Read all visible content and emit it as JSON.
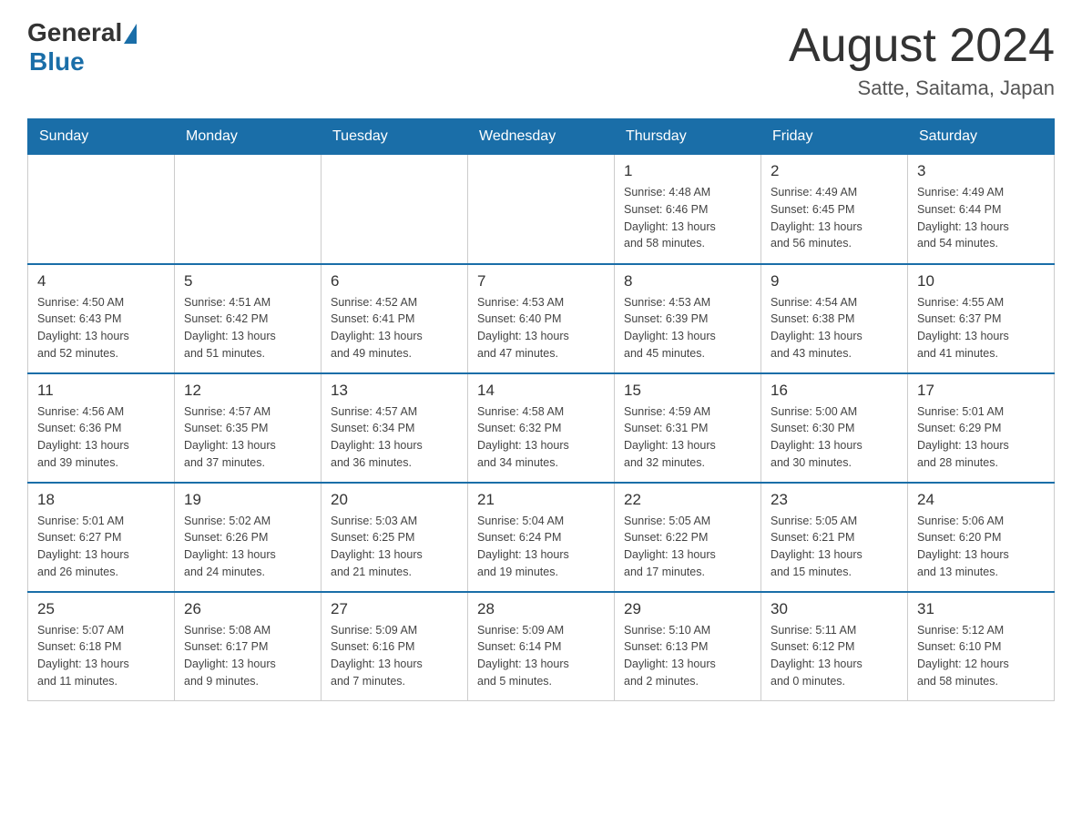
{
  "header": {
    "logo_general": "General",
    "logo_blue": "Blue",
    "title": "August 2024",
    "location": "Satte, Saitama, Japan"
  },
  "weekdays": [
    "Sunday",
    "Monday",
    "Tuesday",
    "Wednesday",
    "Thursday",
    "Friday",
    "Saturday"
  ],
  "weeks": [
    [
      {
        "day": "",
        "info": ""
      },
      {
        "day": "",
        "info": ""
      },
      {
        "day": "",
        "info": ""
      },
      {
        "day": "",
        "info": ""
      },
      {
        "day": "1",
        "info": "Sunrise: 4:48 AM\nSunset: 6:46 PM\nDaylight: 13 hours\nand 58 minutes."
      },
      {
        "day": "2",
        "info": "Sunrise: 4:49 AM\nSunset: 6:45 PM\nDaylight: 13 hours\nand 56 minutes."
      },
      {
        "day": "3",
        "info": "Sunrise: 4:49 AM\nSunset: 6:44 PM\nDaylight: 13 hours\nand 54 minutes."
      }
    ],
    [
      {
        "day": "4",
        "info": "Sunrise: 4:50 AM\nSunset: 6:43 PM\nDaylight: 13 hours\nand 52 minutes."
      },
      {
        "day": "5",
        "info": "Sunrise: 4:51 AM\nSunset: 6:42 PM\nDaylight: 13 hours\nand 51 minutes."
      },
      {
        "day": "6",
        "info": "Sunrise: 4:52 AM\nSunset: 6:41 PM\nDaylight: 13 hours\nand 49 minutes."
      },
      {
        "day": "7",
        "info": "Sunrise: 4:53 AM\nSunset: 6:40 PM\nDaylight: 13 hours\nand 47 minutes."
      },
      {
        "day": "8",
        "info": "Sunrise: 4:53 AM\nSunset: 6:39 PM\nDaylight: 13 hours\nand 45 minutes."
      },
      {
        "day": "9",
        "info": "Sunrise: 4:54 AM\nSunset: 6:38 PM\nDaylight: 13 hours\nand 43 minutes."
      },
      {
        "day": "10",
        "info": "Sunrise: 4:55 AM\nSunset: 6:37 PM\nDaylight: 13 hours\nand 41 minutes."
      }
    ],
    [
      {
        "day": "11",
        "info": "Sunrise: 4:56 AM\nSunset: 6:36 PM\nDaylight: 13 hours\nand 39 minutes."
      },
      {
        "day": "12",
        "info": "Sunrise: 4:57 AM\nSunset: 6:35 PM\nDaylight: 13 hours\nand 37 minutes."
      },
      {
        "day": "13",
        "info": "Sunrise: 4:57 AM\nSunset: 6:34 PM\nDaylight: 13 hours\nand 36 minutes."
      },
      {
        "day": "14",
        "info": "Sunrise: 4:58 AM\nSunset: 6:32 PM\nDaylight: 13 hours\nand 34 minutes."
      },
      {
        "day": "15",
        "info": "Sunrise: 4:59 AM\nSunset: 6:31 PM\nDaylight: 13 hours\nand 32 minutes."
      },
      {
        "day": "16",
        "info": "Sunrise: 5:00 AM\nSunset: 6:30 PM\nDaylight: 13 hours\nand 30 minutes."
      },
      {
        "day": "17",
        "info": "Sunrise: 5:01 AM\nSunset: 6:29 PM\nDaylight: 13 hours\nand 28 minutes."
      }
    ],
    [
      {
        "day": "18",
        "info": "Sunrise: 5:01 AM\nSunset: 6:27 PM\nDaylight: 13 hours\nand 26 minutes."
      },
      {
        "day": "19",
        "info": "Sunrise: 5:02 AM\nSunset: 6:26 PM\nDaylight: 13 hours\nand 24 minutes."
      },
      {
        "day": "20",
        "info": "Sunrise: 5:03 AM\nSunset: 6:25 PM\nDaylight: 13 hours\nand 21 minutes."
      },
      {
        "day": "21",
        "info": "Sunrise: 5:04 AM\nSunset: 6:24 PM\nDaylight: 13 hours\nand 19 minutes."
      },
      {
        "day": "22",
        "info": "Sunrise: 5:05 AM\nSunset: 6:22 PM\nDaylight: 13 hours\nand 17 minutes."
      },
      {
        "day": "23",
        "info": "Sunrise: 5:05 AM\nSunset: 6:21 PM\nDaylight: 13 hours\nand 15 minutes."
      },
      {
        "day": "24",
        "info": "Sunrise: 5:06 AM\nSunset: 6:20 PM\nDaylight: 13 hours\nand 13 minutes."
      }
    ],
    [
      {
        "day": "25",
        "info": "Sunrise: 5:07 AM\nSunset: 6:18 PM\nDaylight: 13 hours\nand 11 minutes."
      },
      {
        "day": "26",
        "info": "Sunrise: 5:08 AM\nSunset: 6:17 PM\nDaylight: 13 hours\nand 9 minutes."
      },
      {
        "day": "27",
        "info": "Sunrise: 5:09 AM\nSunset: 6:16 PM\nDaylight: 13 hours\nand 7 minutes."
      },
      {
        "day": "28",
        "info": "Sunrise: 5:09 AM\nSunset: 6:14 PM\nDaylight: 13 hours\nand 5 minutes."
      },
      {
        "day": "29",
        "info": "Sunrise: 5:10 AM\nSunset: 6:13 PM\nDaylight: 13 hours\nand 2 minutes."
      },
      {
        "day": "30",
        "info": "Sunrise: 5:11 AM\nSunset: 6:12 PM\nDaylight: 13 hours\nand 0 minutes."
      },
      {
        "day": "31",
        "info": "Sunrise: 5:12 AM\nSunset: 6:10 PM\nDaylight: 12 hours\nand 58 minutes."
      }
    ]
  ]
}
